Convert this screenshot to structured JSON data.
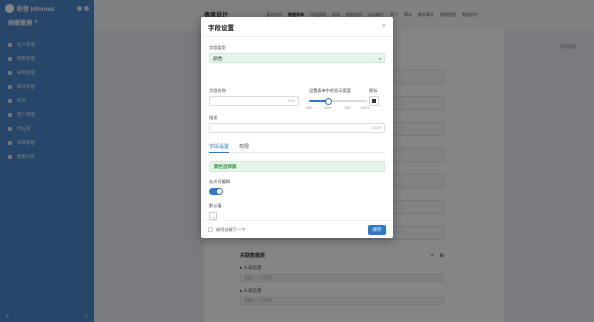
{
  "app": {
    "name": "织信 Informat",
    "workspace": "档案管理"
  },
  "sidebar": {
    "items": [
      {
        "label": "生产管理",
        "has_arrow": false
      },
      {
        "label": "销售管理",
        "has_arrow": true
      },
      {
        "label": "采购管理",
        "has_arrow": false
      },
      {
        "label": "库存管理",
        "has_arrow": false
      },
      {
        "label": "财务",
        "has_arrow": true
      },
      {
        "label": "客户管理",
        "has_arrow": false
      },
      {
        "label": "供应商",
        "has_arrow": false
      },
      {
        "label": "项目管理",
        "has_arrow": false
      },
      {
        "label": "数据分析",
        "has_arrow": false
      }
    ],
    "footer_left": "≡",
    "footer_right": "◐"
  },
  "background": {
    "page_title": "表单设计",
    "tabs": [
      "基本信息",
      "数据表单",
      "字段管理",
      "权限",
      "数据校验",
      "自动编号",
      "索引",
      "脚本",
      "触发事件",
      "数据视图",
      "数据同步"
    ],
    "side_link": "字段管理",
    "section_title": "关联数据表",
    "section_actions": [
      "+",
      "⚙"
    ],
    "sub_items": [
      {
        "label": "▸ 人员信息",
        "placeholder": "请输入人员信息"
      },
      {
        "label": "▸ 人员信息",
        "placeholder": "请输入人员信息"
      }
    ]
  },
  "modal": {
    "title": "字段设置",
    "field_type_label": "字段类型",
    "field_type_value": "颜色",
    "field_name_label": "字段名称",
    "field_name_value": "",
    "field_name_counter": "0/30",
    "width_label": "设置表单中的显示宽度",
    "width_marks": [
      "25%",
      "50%",
      "75%",
      "100%"
    ],
    "width_value": 50,
    "icon_label": "图标",
    "description_label": "描述",
    "description_counter": "0/100",
    "subtabs": [
      "字段设置",
      "权限"
    ],
    "active_subtab": 0,
    "info_text": "颜色选择器",
    "allow_edit_label": "允许可编辑",
    "allow_edit": true,
    "default_label": "默认值",
    "default_swatch_glyph": "—",
    "footer_checkbox_label": "继续创建下一个",
    "save_label": "保存",
    "close_glyph": "×",
    "caret_glyph": "▾"
  },
  "colors": {
    "accent": "#2f79c8",
    "sidebar": "#4b86c9",
    "success_bg": "#e6f5e9",
    "success_text": "#3a9a4a"
  }
}
